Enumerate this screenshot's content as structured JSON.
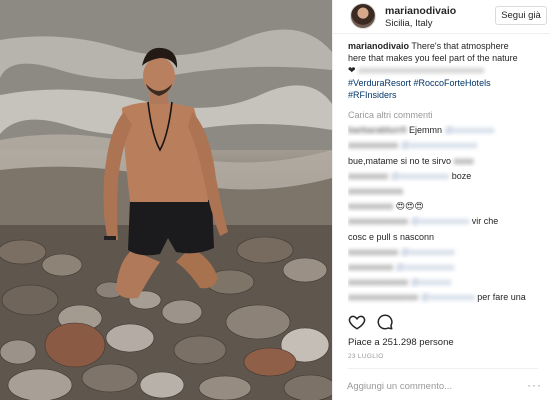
{
  "header": {
    "username": "marianodivaio",
    "location": "Sicilia, Italy",
    "follow_label": "Segui già"
  },
  "caption": {
    "username": "marianodivaio",
    "text_line1": " There's that atmosphere",
    "text_line2": "here that makes you feel part of the nature",
    "heart": "❤",
    "hashtag_line1": "#VerduraResort #RoccoForteHotels",
    "hashtag_line2": "#RFInsiders"
  },
  "load_more_label": "Carica altri commenti",
  "comments": [
    {
      "text": "Ejemmn"
    },
    {
      "text": ""
    },
    {
      "text": "bue,matame si no te sirvo"
    },
    {
      "text": " boze"
    },
    {
      "text": ""
    },
    {
      "text": "😍😍😍"
    },
    {
      "text": " vir che"
    },
    {
      "text": "cosc e pull s nasconn"
    },
    {
      "text": ""
    },
    {
      "text": ""
    },
    {
      "text": ""
    },
    {
      "text": ""
    },
    {
      "text": " per fare una"
    }
  ],
  "actions": {
    "like_icon": "heart-outline-icon",
    "comment_icon": "speech-bubble-icon"
  },
  "likes_text": "Piace a 251.298 persone",
  "date_text": "23 LUGLIO",
  "add_comment_placeholder": "Aggiungi un commento...",
  "more_label": "···",
  "colors": {
    "hashtag": "#003569",
    "muted": "#999999",
    "text": "#262626",
    "border": "#efefef"
  }
}
